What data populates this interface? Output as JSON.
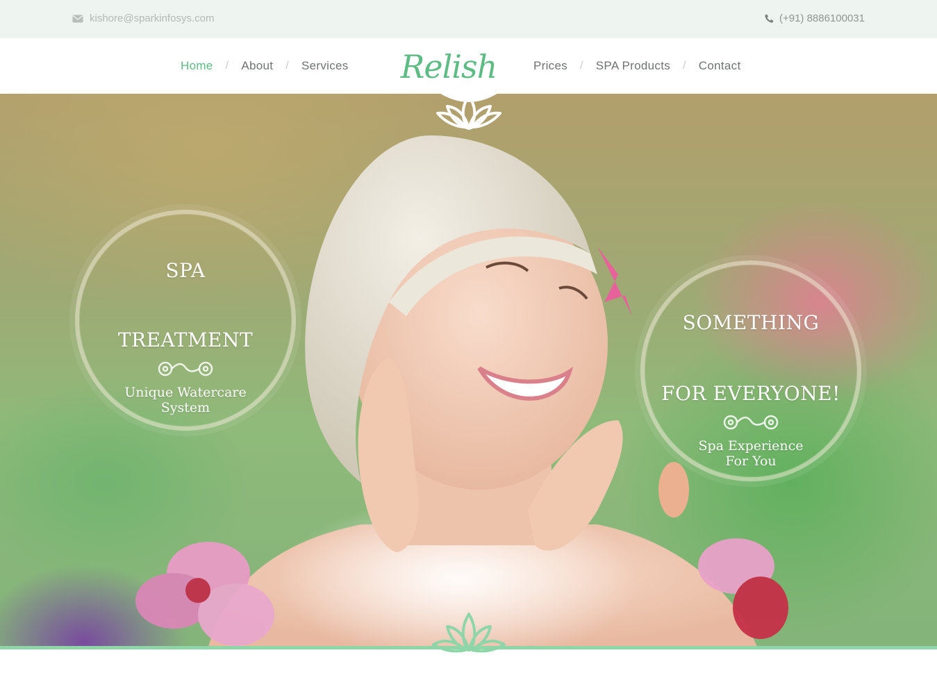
{
  "topbar": {
    "email": "kishore@sparkinfosys.com",
    "email_icon": "envelope-icon",
    "phone": "(+91) 8886100031",
    "phone_icon": "phone-icon"
  },
  "nav": {
    "left": [
      {
        "label": "Home",
        "active": true
      },
      {
        "label": "About"
      },
      {
        "label": "Services"
      }
    ],
    "right": [
      {
        "label": "Prices"
      },
      {
        "label": "SPA Products"
      },
      {
        "label": "Contact"
      }
    ],
    "separator": "/",
    "logo_text": "Relish",
    "logo_icon": "lotus-icon"
  },
  "hero": {
    "left_circle": {
      "title_line1": "SPA",
      "title_line2": "TREATMENT",
      "subtitle_line1": "Unique Watercare",
      "subtitle_line2": "System"
    },
    "right_circle": {
      "title_line1": "SOMETHING",
      "title_line2": "FOR EVERYONE!",
      "subtitle_line1": "Spa Experience",
      "subtitle_line2": "For You"
    }
  },
  "colors": {
    "accent": "#5dbb83",
    "topbar_bg": "#eef4ef",
    "rule": "#8ed6a8"
  }
}
